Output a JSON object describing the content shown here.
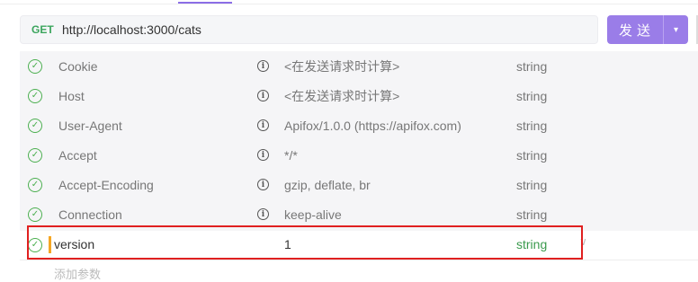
{
  "request": {
    "method": "GET",
    "url": "http://localhost:3000/cats",
    "send_label": "发送"
  },
  "headers": [
    {
      "name": "Cookie",
      "value": "<在发送请求时计算>",
      "type": "string"
    },
    {
      "name": "Host",
      "value": "<在发送请求时计算>",
      "type": "string"
    },
    {
      "name": "User-Agent",
      "value": "Apifox/1.0.0 (https://apifox.com)",
      "type": "string"
    },
    {
      "name": "Accept",
      "value": "*/*",
      "type": "string"
    },
    {
      "name": "Accept-Encoding",
      "value": "gzip, deflate, br",
      "type": "string"
    },
    {
      "name": "Connection",
      "value": "keep-alive",
      "type": "string"
    }
  ],
  "custom_header": {
    "name": "version",
    "value": "1",
    "type": "string"
  },
  "add_param_placeholder": "添加参数",
  "colors": {
    "accent": "#9a7de8",
    "check_green": "#4caf50",
    "highlight_red": "#e02020",
    "type_green": "#3a9a4d"
  }
}
